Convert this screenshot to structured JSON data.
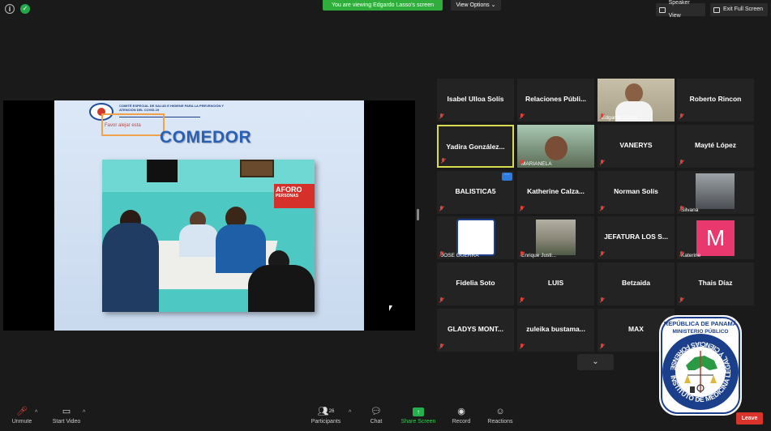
{
  "top_bar": {
    "viewing_banner": "You are viewing Edgardo Lasso's screen",
    "view_options": "View Options",
    "speaker_view": "Speaker View",
    "exit_full_screen": "Exit Full Screen"
  },
  "shared_slide": {
    "header": "COMITÉ ESPECIAL DE SALUD E HIGIENE PARA LA PREVENCIÓN Y ATENCIÓN DEL COVID-19",
    "orange_note": "Favor alejar esta",
    "title": "COMEDOR",
    "aforo_sign": "AFORO",
    "aforo_sub": "PERSONAS"
  },
  "gallery": {
    "tiles": [
      {
        "name": "Isabel Ulloa Solís",
        "kind": "name"
      },
      {
        "name": "Relaciones  Públi...",
        "kind": "name"
      },
      {
        "name": "Edgardo Lasso",
        "kind": "video"
      },
      {
        "name": "Roberto Rincon",
        "kind": "name"
      },
      {
        "name": "Yadira  González...",
        "kind": "name"
      },
      {
        "name": "MARIANELA",
        "kind": "video"
      },
      {
        "name": "VANERYS",
        "kind": "name"
      },
      {
        "name": "Mayté López",
        "kind": "name"
      },
      {
        "name": "BALISTICA5",
        "kind": "name"
      },
      {
        "name": "Katherine  Calza...",
        "kind": "name"
      },
      {
        "name": "Norman Solís",
        "kind": "name"
      },
      {
        "name": "Silvana",
        "kind": "video"
      },
      {
        "name": "JOSE GUERRA",
        "kind": "video"
      },
      {
        "name": "Enrique Justi...",
        "kind": "video"
      },
      {
        "name": "JEFATURA  LOS S...",
        "kind": "name"
      },
      {
        "name": "Katerine",
        "kind": "avatar",
        "letter": "M"
      },
      {
        "name": "Fidelia Soto",
        "kind": "name"
      },
      {
        "name": "LUIS",
        "kind": "name"
      },
      {
        "name": "Betzaida",
        "kind": "name"
      },
      {
        "name": "Thais Díaz",
        "kind": "name"
      },
      {
        "name": "GLADYS  MONT...",
        "kind": "name"
      },
      {
        "name": "zuleika  bustama...",
        "kind": "name"
      },
      {
        "name": "MAX",
        "kind": "name"
      }
    ],
    "more_dots": "···",
    "scroll_down": "⌄"
  },
  "seal": {
    "line1": "REPÚBLICA DE PANAMÁ",
    "line2": "MINISTERIO PÚBLICO",
    "ring_text": "INSTITUTO DE MEDICINA LEGAL Y CIENCIAS FORENSES"
  },
  "toolbar": {
    "unmute": "Unmute",
    "start_video": "Start Video",
    "participants": "Participants",
    "participants_count": "26",
    "chat": "Chat",
    "share_screen": "Share Screen",
    "record": "Record",
    "reactions": "Reactions",
    "leave": "Leave"
  },
  "colors": {
    "banner_green": "#2fae3c",
    "active_speaker": "#d8dc4e",
    "leave_red": "#d8342c",
    "avatar_pink": "#e8386e"
  }
}
